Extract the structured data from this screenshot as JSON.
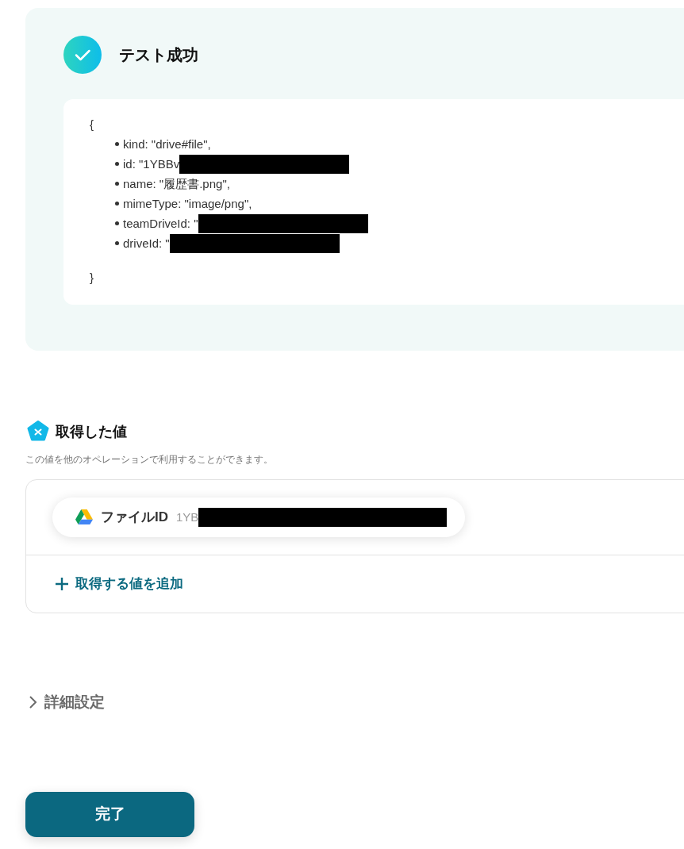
{
  "test_result": {
    "title": "テスト成功",
    "open_brace": "{",
    "close_brace": "}",
    "fields": [
      {
        "text": "kind: \"drive#file\",",
        "redacted": false
      },
      {
        "text": "id: \"1YBBv",
        "redacted": true
      },
      {
        "text": "name: \"履歴書.png\",",
        "redacted": false
      },
      {
        "text": "mimeType: \"image/png\",",
        "redacted": false
      },
      {
        "text": "teamDriveId: \"",
        "redacted": true
      },
      {
        "text": "driveId: \"",
        "redacted": true
      }
    ]
  },
  "acquired_values": {
    "title": "取得した値",
    "description": "この値を他のオペレーションで利用することができます。",
    "items": [
      {
        "label": "ファイルID",
        "value": "1YB",
        "redacted": true
      }
    ],
    "add_button": "取得する値を追加"
  },
  "advanced_settings": {
    "label": "詳細設定",
    "expanded": false
  },
  "done_button": "完了"
}
